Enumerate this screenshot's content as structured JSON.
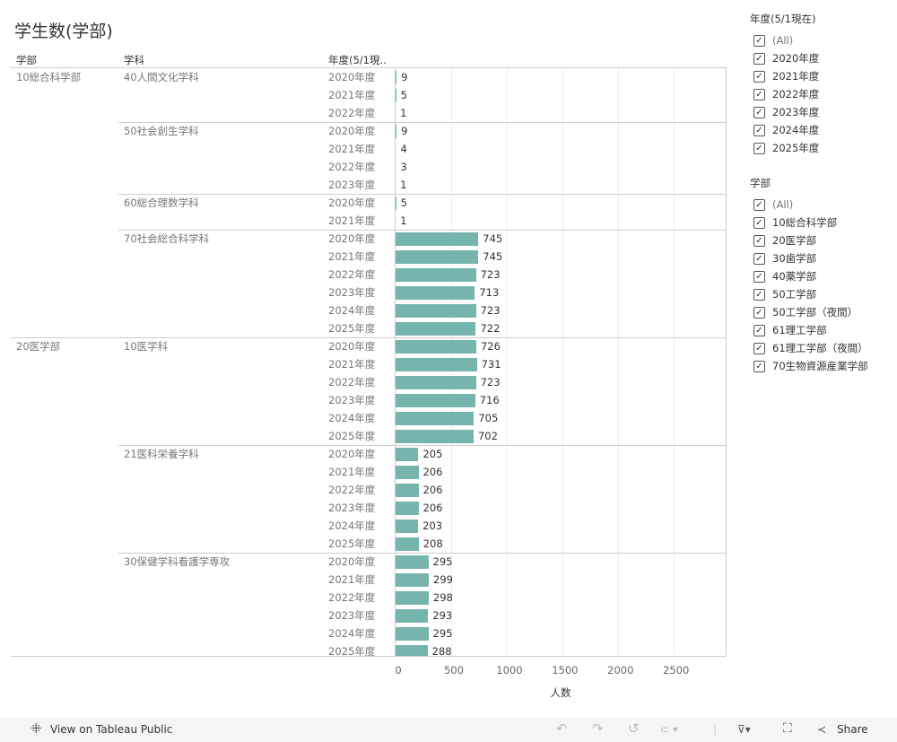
{
  "title": "学生数(学部)",
  "headers": {
    "faculty": "学部",
    "department": "学科",
    "year": "年度(5/1現.."
  },
  "chart_data": {
    "type": "bar",
    "orientation": "horizontal",
    "xlabel": "人数",
    "xlim": [
      0,
      2970
    ],
    "xticks": [
      0,
      500,
      1000,
      1500,
      2000,
      2500
    ],
    "bar_color": "#76b5ae",
    "groups": [
      {
        "faculty": "10総合科学部",
        "departments": [
          {
            "name": "40人間文化学科",
            "rows": [
              {
                "year": "2020年度",
                "value": 9
              },
              {
                "year": "2021年度",
                "value": 5
              },
              {
                "year": "2022年度",
                "value": 1
              }
            ]
          },
          {
            "name": "50社会創生学科",
            "rows": [
              {
                "year": "2020年度",
                "value": 9
              },
              {
                "year": "2021年度",
                "value": 4
              },
              {
                "year": "2022年度",
                "value": 3
              },
              {
                "year": "2023年度",
                "value": 1
              }
            ]
          },
          {
            "name": "60総合理数学科",
            "rows": [
              {
                "year": "2020年度",
                "value": 5
              },
              {
                "year": "2021年度",
                "value": 1
              }
            ]
          },
          {
            "name": "70社会総合科学科",
            "rows": [
              {
                "year": "2020年度",
                "value": 745
              },
              {
                "year": "2021年度",
                "value": 745
              },
              {
                "year": "2022年度",
                "value": 723
              },
              {
                "year": "2023年度",
                "value": 713
              },
              {
                "year": "2024年度",
                "value": 723
              },
              {
                "year": "2025年度",
                "value": 722
              }
            ]
          }
        ]
      },
      {
        "faculty": "20医学部",
        "departments": [
          {
            "name": "10医学科",
            "rows": [
              {
                "year": "2020年度",
                "value": 726
              },
              {
                "year": "2021年度",
                "value": 731
              },
              {
                "year": "2022年度",
                "value": 723
              },
              {
                "year": "2023年度",
                "value": 716
              },
              {
                "year": "2024年度",
                "value": 705
              },
              {
                "year": "2025年度",
                "value": 702
              }
            ]
          },
          {
            "name": "21医科栄養学科",
            "rows": [
              {
                "year": "2020年度",
                "value": 205
              },
              {
                "year": "2021年度",
                "value": 206
              },
              {
                "year": "2022年度",
                "value": 206
              },
              {
                "year": "2023年度",
                "value": 206
              },
              {
                "year": "2024年度",
                "value": 203
              },
              {
                "year": "2025年度",
                "value": 208
              }
            ]
          },
          {
            "name": "30保健学科看護学専攻",
            "rows": [
              {
                "year": "2020年度",
                "value": 295
              },
              {
                "year": "2021年度",
                "value": 299
              },
              {
                "year": "2022年度",
                "value": 298
              },
              {
                "year": "2023年度",
                "value": 293
              },
              {
                "year": "2024年度",
                "value": 295
              },
              {
                "year": "2025年度",
                "value": 288
              }
            ]
          }
        ]
      }
    ]
  },
  "filters": [
    {
      "title": "年度(5/1現在)",
      "items": [
        "(All)",
        "2020年度",
        "2021年度",
        "2022年度",
        "2023年度",
        "2024年度",
        "2025年度"
      ]
    },
    {
      "title": "学部",
      "items": [
        "(All)",
        "10総合科学部",
        "20医学部",
        "30歯学部",
        "40薬学部",
        "50工学部",
        "50工学部（夜間）",
        "61理工学部",
        "61理工学部（夜間）",
        "70生物資源産業学部"
      ]
    }
  ],
  "toolbar": {
    "view_label": "View on Tableau Public",
    "share_label": "Share"
  }
}
